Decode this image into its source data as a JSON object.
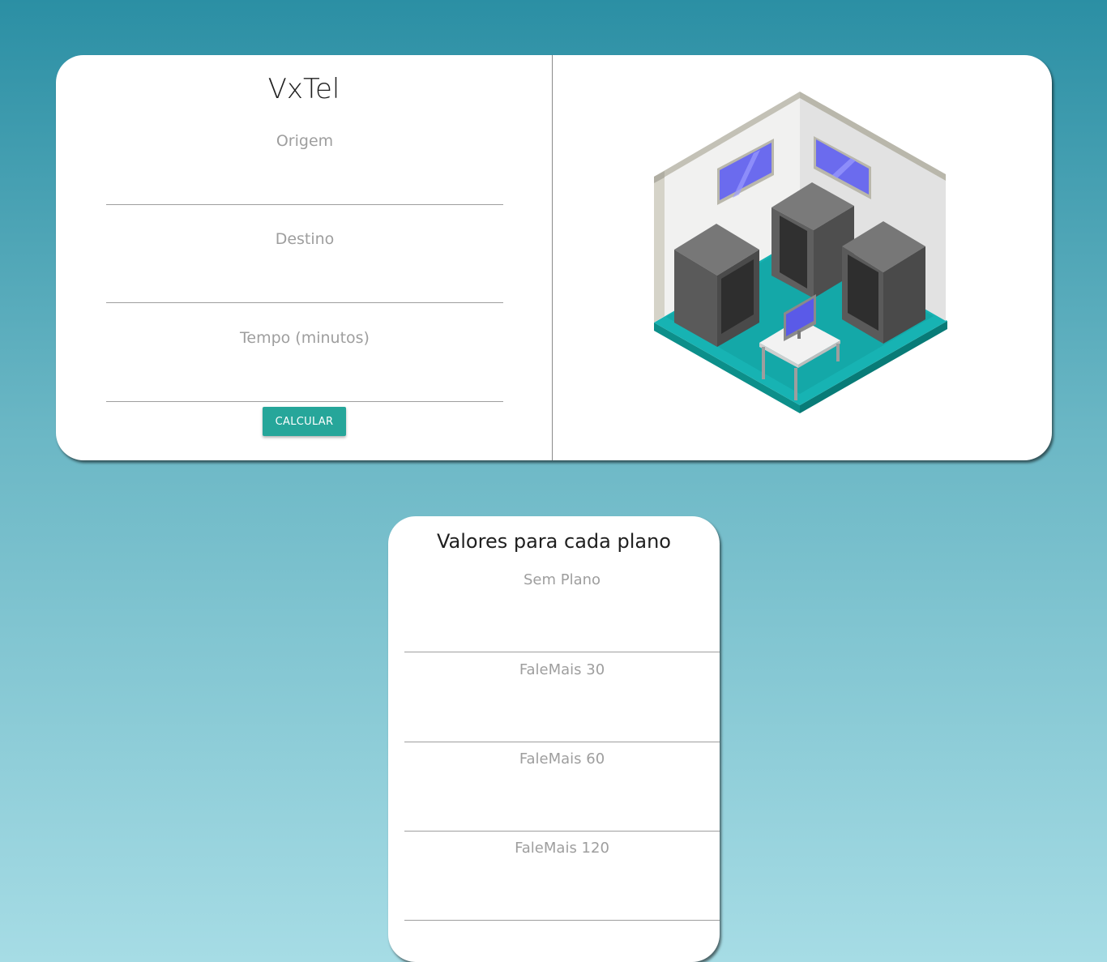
{
  "app": {
    "title": "VxTel"
  },
  "form": {
    "origem_label": "Origem",
    "destino_label": "Destino",
    "tempo_label": "Tempo (minutos)",
    "origem_value": "",
    "destino_value": "",
    "tempo_value": "",
    "calcular_label": "CALCULAR"
  },
  "illustration": {
    "icon": "server-room-illustration"
  },
  "plans": {
    "title": "Valores para cada plano",
    "items": [
      {
        "label": "Sem Plano",
        "value": ""
      },
      {
        "label": "FaleMais 30",
        "value": ""
      },
      {
        "label": "FaleMais 60",
        "value": ""
      },
      {
        "label": "FaleMais 120",
        "value": ""
      }
    ]
  },
  "colors": {
    "accent": "#26a69a",
    "background_top": "#2b8fa4",
    "background_bottom": "#a6dce5"
  }
}
